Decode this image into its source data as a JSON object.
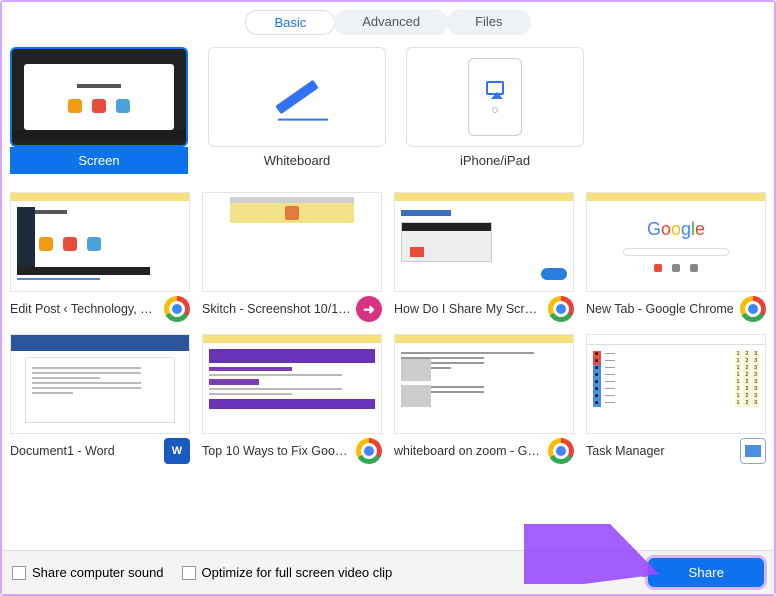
{
  "tabs": {
    "basic": "Basic",
    "advanced": "Advanced",
    "files": "Files",
    "active": "basic"
  },
  "primary_options": {
    "screen": {
      "label": "Screen",
      "selected": true
    },
    "whiteboard": {
      "label": "Whiteboard"
    },
    "iphone": {
      "label": "iPhone/iPad"
    }
  },
  "windows": [
    {
      "label": "Edit Post ‹ Technology, B…",
      "app_icon": "chrome-icon"
    },
    {
      "label": "Skitch - Screenshot 10/1…",
      "app_icon": "skitch-icon"
    },
    {
      "label": "How Do I Share My Scre…",
      "app_icon": "chrome-icon"
    },
    {
      "label": "New Tab - Google Chrome",
      "app_icon": "chrome-icon"
    },
    {
      "label": "Document1 - Word",
      "app_icon": "word-icon"
    },
    {
      "label": "Top 10 Ways to Fix Goog…",
      "app_icon": "chrome-icon"
    },
    {
      "label": "whiteboard on zoom - G…",
      "app_icon": "chrome-icon"
    },
    {
      "label": "Task Manager",
      "app_icon": "task-manager-icon"
    }
  ],
  "footer": {
    "share_sound_label": "Share computer sound",
    "optimize_label": "Optimize for full screen video clip",
    "share_button": "Share"
  },
  "thumbs": {
    "google_logo": "Google"
  }
}
